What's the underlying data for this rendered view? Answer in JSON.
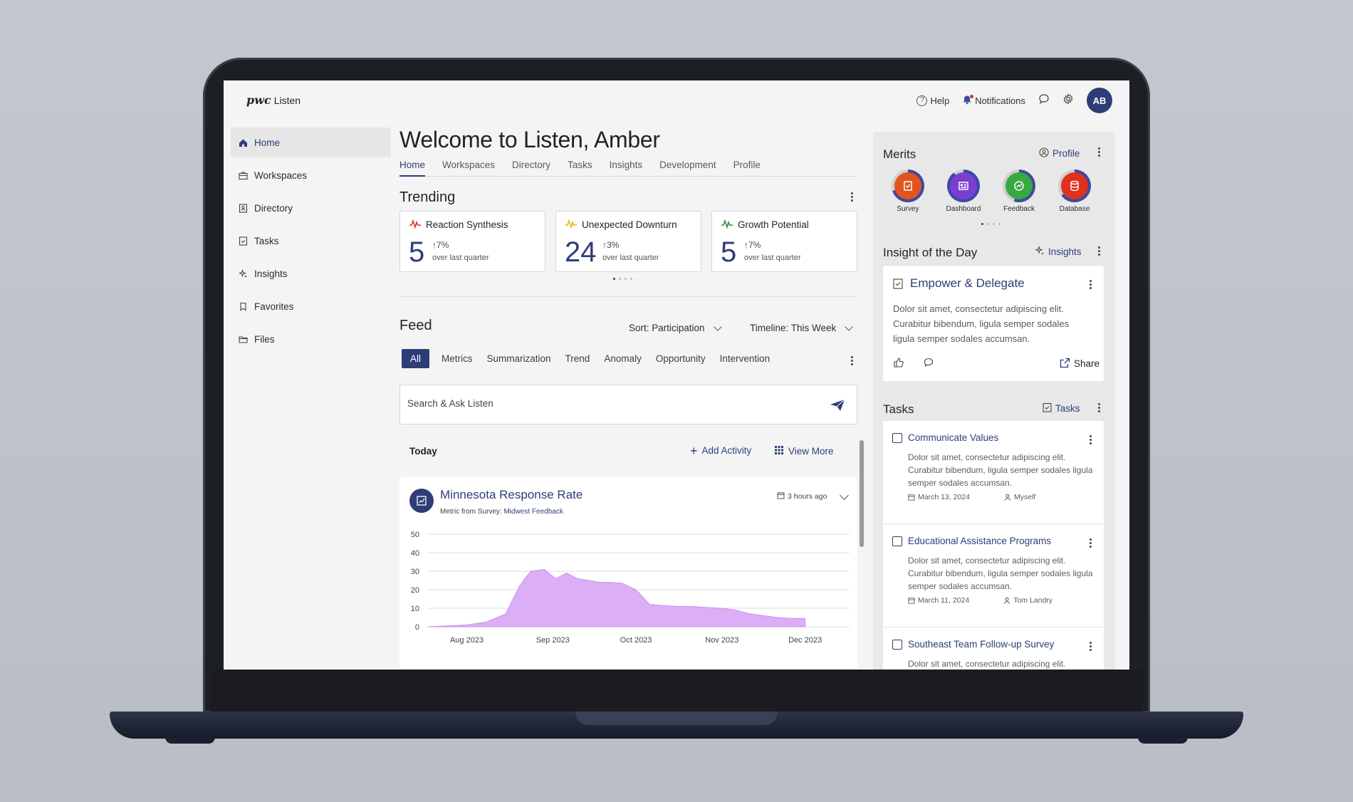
{
  "app": {
    "logo_mark": "pwc",
    "logo_text": "Listen"
  },
  "header": {
    "help": "Help",
    "notifications": "Notifications",
    "avatar_initials": "AB"
  },
  "sidebar": {
    "items": [
      {
        "label": "Home",
        "icon": "home-icon",
        "active": true
      },
      {
        "label": "Workspaces",
        "icon": "briefcase-icon"
      },
      {
        "label": "Directory",
        "icon": "directory-icon"
      },
      {
        "label": "Tasks",
        "icon": "checkbox-icon"
      },
      {
        "label": "Insights",
        "icon": "sparkle-icon"
      },
      {
        "label": "Favorites",
        "icon": "bookmark-icon"
      },
      {
        "label": "Files",
        "icon": "folder-icon"
      }
    ]
  },
  "main": {
    "welcome": "Welcome to Listen, Amber",
    "tabs": [
      "Home",
      "Workspaces",
      "Directory",
      "Tasks",
      "Insights",
      "Development",
      "Profile"
    ],
    "trending": {
      "title": "Trending",
      "cards": [
        {
          "title": "Reaction Synthesis",
          "value": "5",
          "change": "7%",
          "note": "over last quarter",
          "color": "#e0301e"
        },
        {
          "title": "Unexpected Downturn",
          "value": "24",
          "change": "3%",
          "note": "over last quarter",
          "color": "#e5b800"
        },
        {
          "title": "Growth Potential",
          "value": "5",
          "change": "7%",
          "note": "over last quarter",
          "color": "#2e8b3d"
        }
      ]
    },
    "feed": {
      "title": "Feed",
      "sort": "Sort: Participation",
      "timeline": "Timeline: This Week",
      "filters": [
        "All",
        "Metrics",
        "Summarization",
        "Trend",
        "Anomaly",
        "Opportunity",
        "Intervention"
      ],
      "search_placeholder": "Search & Ask Listen",
      "today": "Today",
      "add_activity": "Add Activity",
      "view_more": "View More",
      "card": {
        "title": "Minnesota Response Rate",
        "sub_prefix": "Metric from Survey:",
        "sub_link": "Midwest Feedback",
        "time": "3 hours ago"
      }
    }
  },
  "chart_data": {
    "type": "area",
    "x": [
      "2023-08-01",
      "2023-08-08",
      "2023-08-15",
      "2023-08-22",
      "2023-08-29",
      "2023-09-03",
      "2023-09-07",
      "2023-09-12",
      "2023-09-16",
      "2023-09-20",
      "2023-09-24",
      "2023-09-28",
      "2023-10-02",
      "2023-10-06",
      "2023-10-10",
      "2023-10-15",
      "2023-10-20",
      "2023-10-25",
      "2023-10-30",
      "2023-11-04",
      "2023-11-09",
      "2023-11-15",
      "2023-11-20",
      "2023-11-25",
      "2023-11-30",
      "2023-12-05",
      "2023-12-10",
      "2023-12-15"
    ],
    "y": [
      0,
      0.5,
      1,
      2.5,
      7,
      22,
      30,
      31,
      26,
      29,
      26,
      25,
      24,
      24,
      23.5,
      20,
      12,
      11.5,
      11,
      11,
      10.5,
      10,
      9,
      7,
      6,
      5,
      4.5,
      4.5
    ],
    "xticks": [
      "Aug 2023",
      "Sep 2023",
      "Oct 2023",
      "Nov 2023",
      "Dec 2023"
    ],
    "yticks": [
      "0",
      "10",
      "20",
      "30",
      "40",
      "50"
    ],
    "ylim": [
      0,
      50
    ],
    "grid": true,
    "color": "#dcaef5"
  },
  "right": {
    "merits": {
      "title": "Merits",
      "profile_link": "Profile",
      "items": [
        {
          "label": "Survey",
          "color": "#e2541b"
        },
        {
          "label": "Dashboard",
          "color": "#7a3fd1"
        },
        {
          "label": "Feedback",
          "color": "#3aa842"
        },
        {
          "label": "Database",
          "color": "#e0301e"
        }
      ]
    },
    "insight": {
      "title": "Insight of the Day",
      "link": "Insights",
      "card_title": "Empower & Delegate",
      "body": "Dolor sit amet, consectetur adipiscing elit. Curabitur bibendum, ligula semper sodales ligula semper sodales accumsan.",
      "share": "Share"
    },
    "tasks": {
      "title": "Tasks",
      "link": "Tasks",
      "items": [
        {
          "title": "Communicate Values",
          "body": "Dolor sit amet, consectetur adipiscing elit. Curabitur bibendum, ligula semper sodales ligula semper sodales accumsan.",
          "date": "March 13, 2024",
          "owner": "Myself"
        },
        {
          "title": "Educational Assistance Programs",
          "body": "Dolor sit amet, consectetur adipiscing elit. Curabitur bibendum, ligula semper sodales ligula semper sodales accumsan.",
          "date": "March 11, 2024",
          "owner": "Tom Landry"
        },
        {
          "title": "Southeast Team Follow-up Survey",
          "body": "Dolor sit amet, consectetur adipiscing elit.",
          "date": "",
          "owner": ""
        }
      ]
    }
  }
}
